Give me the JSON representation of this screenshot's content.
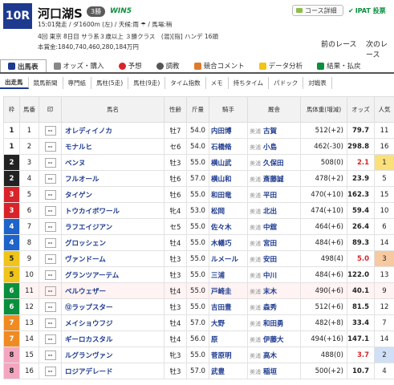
{
  "race": {
    "number": "10R",
    "name": "河口湖S",
    "grade": "3勝",
    "win5": "WIN5",
    "line1": "15:01発走 / ダ1600m (左) / 天候:雨 ☂ / 馬場:稍",
    "line2": "4回 東京 8日目 サラ系３歳以上 ３勝クラス　(混)[指] ハンデ 16頭",
    "line3": "本賞金:1840,740,460,280,184万円",
    "course_btn": "コース詳細",
    "ipat": "IPAT 投票",
    "prev": "前のレース",
    "next": "次のレース"
  },
  "tabs": [
    "出馬表",
    "オッズ・購入",
    "予想",
    "調教",
    "競合コメント",
    "データ分析",
    "結果・払戻"
  ],
  "subtabs": [
    "出走馬",
    "競馬新聞",
    "専門紙",
    "馬柱(5走)",
    "馬柱(9走)",
    "タイム指数",
    "メモ",
    "持ちタイム",
    "パドック",
    "対戦表"
  ],
  "headers": {
    "waku": "枠",
    "num": "馬番",
    "mark": "印",
    "horse": "馬名",
    "sex": "性齢",
    "kg": "斤量",
    "jockey": "騎手",
    "trainer": "厩舎",
    "bw": "馬体重(増減)",
    "odds": "オッズ",
    "pop": "人気"
  },
  "colors": {
    "waku": [
      "#ffffff",
      "#222222",
      "#d8232a",
      "#1d63c9",
      "#f0c419",
      "#0a8f3c",
      "#f08a22",
      "#f4a6bf"
    ],
    "accent": "#1d3a8f"
  },
  "rows": [
    {
      "waku": "1",
      "num": "1",
      "mark": "--",
      "horse": "オレディイノカ",
      "sex": "牡7",
      "kg": "54.0",
      "jockey": "内田博",
      "reg": "美浦",
      "trainer": "古賀",
      "bw": "512(+2)",
      "odds": "79.7",
      "pop": "11"
    },
    {
      "waku": "1",
      "num": "2",
      "mark": "--",
      "horse": "モナルヒ",
      "sex": "セ6",
      "kg": "54.0",
      "jockey": "石橋脩",
      "reg": "美浦",
      "trainer": "小島",
      "bw": "462(-30)",
      "odds": "298.8",
      "pop": "16"
    },
    {
      "waku": "2",
      "num": "3",
      "mark": "--",
      "horse": "ベンヌ",
      "sex": "牡3",
      "kg": "55.0",
      "jockey": "横山武",
      "reg": "美浦",
      "trainer": "久保田",
      "bw": "508(0)",
      "odds": "2.1",
      "pop": "1"
    },
    {
      "waku": "2",
      "num": "4",
      "mark": "--",
      "horse": "フルオール",
      "sex": "牡6",
      "kg": "57.0",
      "jockey": "横山和",
      "reg": "美浦",
      "trainer": "斎藤誠",
      "bw": "478(+2)",
      "odds": "23.9",
      "pop": "5"
    },
    {
      "waku": "3",
      "num": "5",
      "mark": "--",
      "horse": "タイゲン",
      "sex": "牡6",
      "kg": "55.0",
      "jockey": "和田竜",
      "reg": "美浦",
      "trainer": "平田",
      "bw": "470(+10)",
      "odds": "162.3",
      "pop": "15"
    },
    {
      "waku": "3",
      "num": "6",
      "mark": "--",
      "horse": "トウカイボワール",
      "sex": "牝4",
      "kg": "53.0",
      "jockey": "松岡",
      "reg": "美浦",
      "trainer": "北出",
      "bw": "474(+10)",
      "odds": "59.4",
      "pop": "10"
    },
    {
      "waku": "4",
      "num": "7",
      "mark": "--",
      "horse": "ラフエイジアン",
      "sex": "セ5",
      "kg": "55.0",
      "jockey": "佐々木",
      "reg": "美浦",
      "trainer": "中舘",
      "bw": "464(+6)",
      "odds": "26.4",
      "pop": "6"
    },
    {
      "waku": "4",
      "num": "8",
      "mark": "--",
      "horse": "グロッシェン",
      "sex": "牡4",
      "kg": "55.0",
      "jockey": "木幡巧",
      "reg": "美浦",
      "trainer": "宮田",
      "bw": "484(+6)",
      "odds": "89.3",
      "pop": "14"
    },
    {
      "waku": "5",
      "num": "9",
      "mark": "--",
      "horse": "ヴァンドーム",
      "sex": "牡3",
      "kg": "55.0",
      "jockey": "ルメール",
      "reg": "美浦",
      "trainer": "安田",
      "bw": "498(4)",
      "odds": "5.0",
      "pop": "3"
    },
    {
      "waku": "5",
      "num": "10",
      "mark": "--",
      "horse": "グランツアーテム",
      "sex": "牡3",
      "kg": "55.0",
      "jockey": "三浦",
      "reg": "美浦",
      "trainer": "中川",
      "bw": "484(+6)",
      "odds": "122.0",
      "pop": "13"
    },
    {
      "waku": "6",
      "num": "11",
      "mark": "--",
      "horse": "ベルウェザー",
      "sex": "牡4",
      "kg": "55.0",
      "jockey": "戸崎圭",
      "reg": "美浦",
      "trainer": "末木",
      "bw": "490(+6)",
      "odds": "40.1",
      "pop": "9"
    },
    {
      "waku": "6",
      "num": "12",
      "mark": "--",
      "horse": "⑫ラップスター",
      "sex": "牡3",
      "kg": "55.0",
      "jockey": "吉田豊",
      "reg": "美浦",
      "trainer": "森秀",
      "bw": "512(+6)",
      "odds": "81.5",
      "pop": "12"
    },
    {
      "waku": "7",
      "num": "13",
      "mark": "--",
      "horse": "メイショウフジ",
      "sex": "牡4",
      "kg": "57.0",
      "jockey": "大野",
      "reg": "美浦",
      "trainer": "和田勇",
      "bw": "482(+8)",
      "odds": "33.4",
      "pop": "7"
    },
    {
      "waku": "7",
      "num": "14",
      "mark": "--",
      "horse": "ギーロカスタル",
      "sex": "牡4",
      "kg": "56.0",
      "jockey": "原",
      "reg": "美浦",
      "trainer": "伊藤大",
      "bw": "494(+16)",
      "odds": "147.1",
      "pop": "14"
    },
    {
      "waku": "8",
      "num": "15",
      "mark": "--",
      "horse": "ルグランヴァン",
      "sex": "牝3",
      "kg": "55.0",
      "jockey": "菅原明",
      "reg": "美浦",
      "trainer": "高木",
      "bw": "488(0)",
      "odds": "3.7",
      "pop": "2"
    },
    {
      "waku": "8",
      "num": "16",
      "mark": "--",
      "horse": "ロジアデレード",
      "sex": "牡3",
      "kg": "57.0",
      "jockey": "武豊",
      "reg": "美浦",
      "trainer": "稲垣",
      "bw": "500(+2)",
      "odds": "10.7",
      "pop": "4"
    }
  ]
}
